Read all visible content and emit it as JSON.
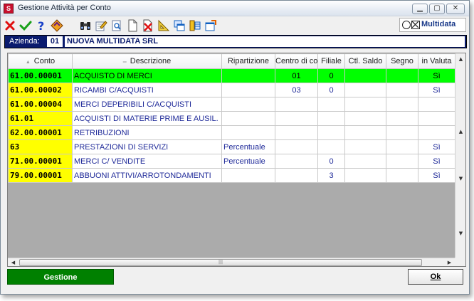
{
  "window": {
    "title": "Gestione Attività per Conto",
    "app_icon_letter": "S",
    "controls": {
      "minimize": "▁",
      "maximize": "▢",
      "close": "✕"
    }
  },
  "toolbar": {
    "buttons": [
      {
        "icon": "cancel-x-icon",
        "color": "#e01010"
      },
      {
        "icon": "confirm-check-icon",
        "color": "#18a018"
      },
      {
        "icon": "help-question-icon",
        "color": "#1840c8"
      },
      {
        "icon": "diamond-tool-icon",
        "color": "#d04000"
      },
      {
        "icon": "binoculars-search-icon",
        "color": "#222222"
      },
      {
        "icon": "edit-pencil-icon",
        "color": "#1060c0"
      },
      {
        "icon": "document-search-icon",
        "color": "#3070c0"
      },
      {
        "icon": "new-document-icon",
        "color": "#ffffff"
      },
      {
        "icon": "delete-document-icon",
        "color": "#e01010"
      },
      {
        "icon": "ruler-triangle-icon",
        "color": "#d0a000"
      },
      {
        "icon": "copy-window-icon",
        "color": "#1060c0"
      },
      {
        "icon": "database-grid-icon",
        "color": "#e0b000"
      },
      {
        "icon": "export-window-icon",
        "color": "#1060c0"
      }
    ],
    "logo_text": "Multidata"
  },
  "azienda": {
    "label": "Azienda:",
    "code": "01",
    "name": "NUOVA MULTIDATA SRL"
  },
  "grid": {
    "columns": [
      "Conto",
      "Descrizione",
      "Ripartizione",
      "Centro di cos",
      "Filiale",
      "Ctl. Saldo",
      "Segno",
      "in Valuta"
    ],
    "rows": [
      {
        "conto": "61.00.00001",
        "descrizione": "ACQUISTO DI MERCI",
        "ripartizione": "",
        "centro": "01",
        "filiale": "0",
        "ctl_saldo": "",
        "segno": "",
        "valuta": "Sì",
        "selected": true
      },
      {
        "conto": "61.00.00002",
        "descrizione": "RICAMBI C/ACQUISTI",
        "ripartizione": "",
        "centro": "03",
        "filiale": "0",
        "ctl_saldo": "",
        "segno": "",
        "valuta": "Sì",
        "selected": false
      },
      {
        "conto": "61.00.00004",
        "descrizione": "MERCI DEPERIBILI C/ACQUISTI",
        "ripartizione": "",
        "centro": "",
        "filiale": "",
        "ctl_saldo": "",
        "segno": "",
        "valuta": "",
        "selected": false
      },
      {
        "conto": "61.01",
        "descrizione": "ACQUISTI DI MATERIE PRIME E AUSIL.",
        "ripartizione": "",
        "centro": "",
        "filiale": "",
        "ctl_saldo": "",
        "segno": "",
        "valuta": "",
        "selected": false
      },
      {
        "conto": "62.00.00001",
        "descrizione": "RETRIBUZIONI",
        "ripartizione": "",
        "centro": "",
        "filiale": "",
        "ctl_saldo": "",
        "segno": "",
        "valuta": "",
        "selected": false
      },
      {
        "conto": "63",
        "descrizione": "PRESTAZIONI DI SERVIZI",
        "ripartizione": "Percentuale",
        "centro": "",
        "filiale": "",
        "ctl_saldo": "",
        "segno": "",
        "valuta": "Sì",
        "selected": false
      },
      {
        "conto": "71.00.00001",
        "descrizione": "MERCI C/ VENDITE",
        "ripartizione": "Percentuale",
        "centro": "",
        "filiale": "0",
        "ctl_saldo": "",
        "segno": "",
        "valuta": "Sì",
        "selected": false
      },
      {
        "conto": "79.00.00001",
        "descrizione": "ABBUONI ATTIVI/ARROTONDAMENTI",
        "ripartizione": "",
        "centro": "",
        "filiale": "3",
        "ctl_saldo": "",
        "segno": "",
        "valuta": "Sì",
        "selected": false
      }
    ]
  },
  "footer": {
    "gestione_label": "Gestione",
    "ok_label": "Ok"
  }
}
